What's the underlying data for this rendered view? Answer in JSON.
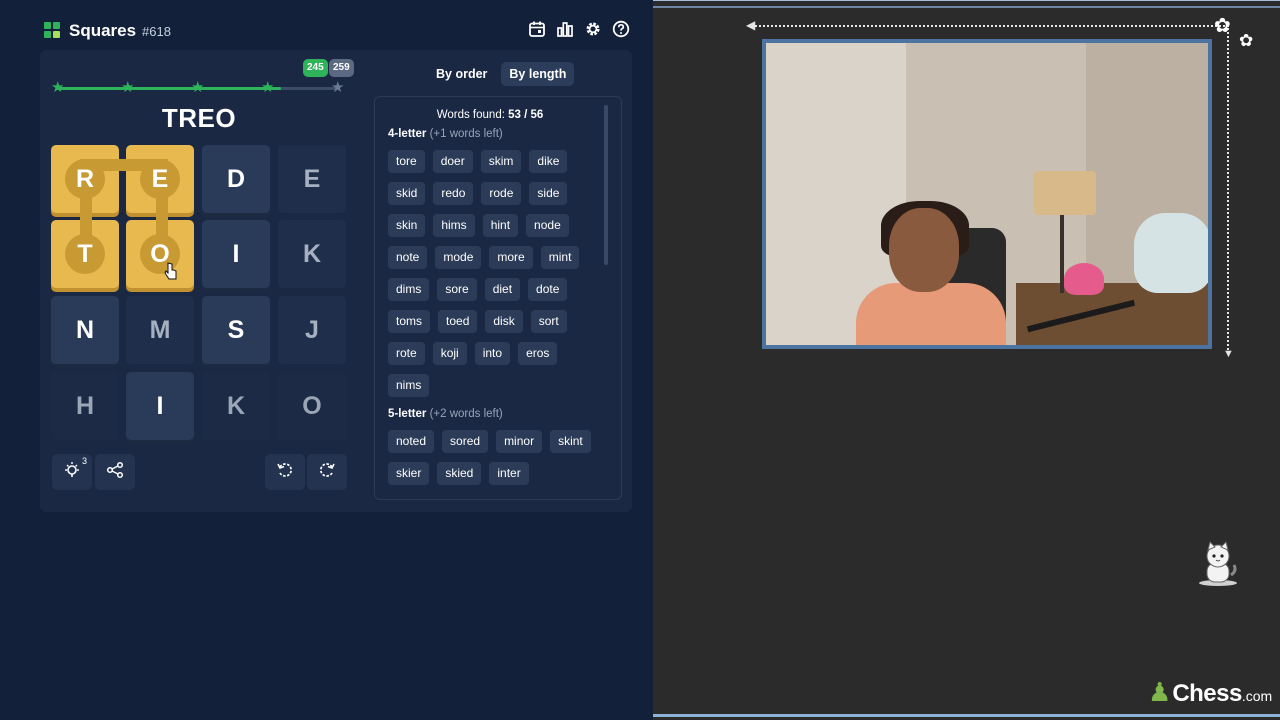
{
  "app": {
    "title": "Squares",
    "puzzle_number": "#618"
  },
  "header_icons": [
    "calendar-icon",
    "stats-icon",
    "settings-icon",
    "help-icon"
  ],
  "progress": {
    "fraction": 0.8,
    "stars": 5,
    "stars_earned": 4,
    "score": "245",
    "target": "259",
    "colors": {
      "earned": "#2fb35a",
      "remaining": "#3c4b66"
    }
  },
  "current_word": "TREO",
  "grid": {
    "rows": [
      [
        "R",
        "E",
        "D",
        "E"
      ],
      [
        "T",
        "O",
        "I",
        "K"
      ],
      [
        "N",
        "M",
        "S",
        "J"
      ],
      [
        "H",
        "I",
        "K",
        "O"
      ]
    ],
    "selected_path": [
      "T",
      "R",
      "E",
      "O"
    ],
    "selected_color": "#e8b94e"
  },
  "tools": {
    "hint_icon": "lightbulb-icon",
    "hint_count": "3",
    "share_icon": "share-icon",
    "undo_icon": "rotate-left-icon",
    "redo_icon": "rotate-right-icon"
  },
  "tabs": [
    {
      "label": "By order",
      "active": false
    },
    {
      "label": "By length",
      "active": true
    }
  ],
  "words": {
    "found_label": "Words found: ",
    "found_count": "53 / 56",
    "sections": [
      {
        "title": "4-letter",
        "note": "(+1 words left)",
        "words": [
          "tore",
          "doer",
          "skim",
          "dike",
          "skid",
          "redo",
          "rode",
          "side",
          "skin",
          "hims",
          "hint",
          "node",
          "note",
          "mode",
          "more",
          "mint",
          "dims",
          "sore",
          "diet",
          "dote",
          "toms",
          "toed",
          "disk",
          "sort",
          "rote",
          "koji",
          "into",
          "eros",
          "nims"
        ]
      },
      {
        "title": "5-letter",
        "note": "(+2 words left)",
        "words": [
          "noted",
          "sored",
          "minor",
          "skint",
          "skier",
          "skied",
          "inter"
        ]
      }
    ]
  },
  "brand": {
    "main": "Chess",
    "suffix": ".com"
  }
}
